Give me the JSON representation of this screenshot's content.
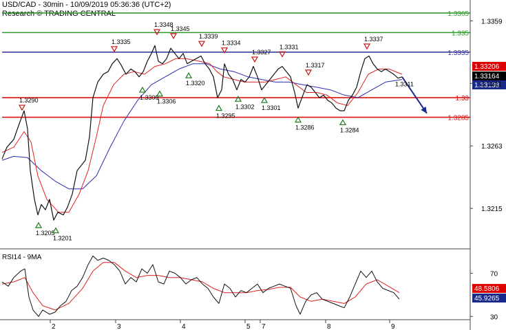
{
  "header": {
    "line1": "USD/CAD - 30min - 10/09/2019 05:36:36 (UTC+2)",
    "line2": "Research © TRADING CENTRAL"
  },
  "rsi_label": "RSI14 - 9MA",
  "chart_data": {
    "type": "line",
    "symbol": "USD/CAD",
    "timeframe": "30min",
    "ylim": [
      1.3185,
      1.3375
    ],
    "rsi_ylim": [
      27,
      90
    ],
    "x_ticks": [
      "2",
      "3",
      "4",
      "5",
      "7",
      "8",
      "9"
    ],
    "y_ticks": [
      "1.3359",
      "1.3311",
      "1.3263",
      "1.3215"
    ],
    "rsi_ticks": [
      "70",
      "30"
    ],
    "levels": [
      {
        "value": 1.3365,
        "label": "1.3365",
        "color": "#2e9a2e"
      },
      {
        "value": 1.335,
        "label": "1.335",
        "color": "#2e9a2e"
      },
      {
        "value": 1.3335,
        "label": "1.3335",
        "color": "#3a3aa0"
      },
      {
        "value": 1.33,
        "label": "1.33",
        "color": "#dd1111"
      },
      {
        "value": 1.3285,
        "label": "1.3285",
        "color": "#dd1111"
      }
    ],
    "price_badges": [
      {
        "label": "1.33206",
        "value": 1.33206,
        "color": "#dd0000"
      },
      {
        "label": "1.33164",
        "value": 1.33164,
        "color": "#000000"
      },
      {
        "label": "1.33138",
        "value": 1.33138,
        "color": "#1a2a8a"
      }
    ],
    "rsi_badges": [
      {
        "label": "48.5806",
        "value": 48.58,
        "color": "#dd0000"
      },
      {
        "label": "45.9265",
        "value": 45.93,
        "color": "#1a2a8a"
      }
    ],
    "annotations": [
      {
        "t": 32,
        "value": 1.329,
        "label": "1.3290",
        "kind": "high"
      },
      {
        "t": 56,
        "value": 1.3205,
        "label": "1.3205",
        "kind": "low"
      },
      {
        "t": 81,
        "value": 1.3201,
        "label": "1.3201",
        "kind": "low"
      },
      {
        "t": 166,
        "value": 1.3335,
        "label": "1.3335",
        "kind": "high"
      },
      {
        "t": 207,
        "value": 1.3309,
        "label": "1.3309",
        "kind": "low"
      },
      {
        "t": 228,
        "value": 1.3348,
        "label": "1.3348",
        "kind": "high"
      },
      {
        "t": 232,
        "value": 1.3306,
        "label": "1.3306",
        "kind": "low"
      },
      {
        "t": 252,
        "value": 1.3345,
        "label": "1.3345",
        "kind": "high"
      },
      {
        "t": 274,
        "value": 1.332,
        "label": "1.3320",
        "kind": "low"
      },
      {
        "t": 293,
        "value": 1.3339,
        "label": "1.3339",
        "kind": "high"
      },
      {
        "t": 318,
        "value": 1.3295,
        "label": "1.3295",
        "kind": "low"
      },
      {
        "t": 326,
        "value": 1.3334,
        "label": "1.3334",
        "kind": "high"
      },
      {
        "t": 346,
        "value": 1.3302,
        "label": "1.3302",
        "kind": "low"
      },
      {
        "t": 370,
        "value": 1.3327,
        "label": "1.3327",
        "kind": "high"
      },
      {
        "t": 384,
        "value": 1.3301,
        "label": "1.3301",
        "kind": "low"
      },
      {
        "t": 410,
        "value": 1.3331,
        "label": "1.3331",
        "kind": "high"
      },
      {
        "t": 433,
        "value": 1.3286,
        "label": "1.3286",
        "kind": "low"
      },
      {
        "t": 448,
        "value": 1.3317,
        "label": "1.3317",
        "kind": "high"
      },
      {
        "t": 498,
        "value": 1.3284,
        "label": "1.3284",
        "kind": "low"
      },
      {
        "t": 533,
        "value": 1.3337,
        "label": "1.3337",
        "kind": "high"
      },
      {
        "t": 580,
        "value": 1.3311,
        "label": "1.3311",
        "kind": "text"
      }
    ],
    "price_path": [
      [
        3,
        1.3253
      ],
      [
        10,
        1.3262
      ],
      [
        20,
        1.3268
      ],
      [
        28,
        1.328
      ],
      [
        35,
        1.329
      ],
      [
        40,
        1.3276
      ],
      [
        44,
        1.3244
      ],
      [
        50,
        1.3222
      ],
      [
        55,
        1.321
      ],
      [
        60,
        1.3218
      ],
      [
        66,
        1.3214
      ],
      [
        72,
        1.3222
      ],
      [
        78,
        1.3206
      ],
      [
        84,
        1.3212
      ],
      [
        92,
        1.321
      ],
      [
        98,
        1.3216
      ],
      [
        105,
        1.3226
      ],
      [
        112,
        1.3244
      ],
      [
        118,
        1.3248
      ],
      [
        124,
        1.3252
      ],
      [
        130,
        1.327
      ],
      [
        135,
        1.33
      ],
      [
        142,
        1.3312
      ],
      [
        150,
        1.3318
      ],
      [
        157,
        1.332
      ],
      [
        163,
        1.3326
      ],
      [
        170,
        1.333
      ],
      [
        176,
        1.3325
      ],
      [
        183,
        1.3318
      ],
      [
        190,
        1.3322
      ],
      [
        196,
        1.332
      ],
      [
        202,
        1.3316
      ],
      [
        208,
        1.332
      ],
      [
        214,
        1.3328
      ],
      [
        220,
        1.3334
      ],
      [
        225,
        1.334
      ],
      [
        230,
        1.3328
      ],
      [
        236,
        1.3326
      ],
      [
        242,
        1.333
      ],
      [
        248,
        1.3338
      ],
      [
        254,
        1.3334
      ],
      [
        260,
        1.333
      ],
      [
        266,
        1.3334
      ],
      [
        272,
        1.3326
      ],
      [
        278,
        1.3328
      ],
      [
        285,
        1.333
      ],
      [
        292,
        1.3332
      ],
      [
        298,
        1.3326
      ],
      [
        304,
        1.3322
      ],
      [
        310,
        1.3316
      ],
      [
        316,
        1.33
      ],
      [
        322,
        1.3306
      ],
      [
        326,
        1.3326
      ],
      [
        332,
        1.3318
      ],
      [
        338,
        1.3314
      ],
      [
        344,
        1.3306
      ],
      [
        350,
        1.3314
      ],
      [
        356,
        1.3312
      ],
      [
        362,
        1.3316
      ],
      [
        368,
        1.3324
      ],
      [
        374,
        1.3316
      ],
      [
        380,
        1.3306
      ],
      [
        386,
        1.331
      ],
      [
        392,
        1.3314
      ],
      [
        398,
        1.3318
      ],
      [
        404,
        1.3322
      ],
      [
        410,
        1.3324
      ],
      [
        416,
        1.332
      ],
      [
        422,
        1.3316
      ],
      [
        428,
        1.3304
      ],
      [
        433,
        1.3292
      ],
      [
        440,
        1.3302
      ],
      [
        446,
        1.331
      ],
      [
        452,
        1.3308
      ],
      [
        458,
        1.3304
      ],
      [
        464,
        1.33
      ],
      [
        470,
        1.3302
      ],
      [
        476,
        1.3298
      ],
      [
        482,
        1.3296
      ],
      [
        488,
        1.3292
      ],
      [
        494,
        1.329
      ],
      [
        500,
        1.329
      ],
      [
        506,
        1.3298
      ],
      [
        512,
        1.3302
      ],
      [
        518,
        1.3308
      ],
      [
        524,
        1.332
      ],
      [
        530,
        1.333
      ],
      [
        536,
        1.3332
      ],
      [
        542,
        1.3326
      ],
      [
        548,
        1.3322
      ],
      [
        554,
        1.332
      ],
      [
        560,
        1.3322
      ],
      [
        566,
        1.332
      ],
      [
        572,
        1.3318
      ],
      [
        578,
        1.3315
      ],
      [
        584,
        1.3316
      ]
    ],
    "ma_fast_path": [
      [
        3,
        1.3258
      ],
      [
        20,
        1.3262
      ],
      [
        35,
        1.3274
      ],
      [
        45,
        1.3266
      ],
      [
        55,
        1.324
      ],
      [
        68,
        1.3222
      ],
      [
        85,
        1.3212
      ],
      [
        100,
        1.3212
      ],
      [
        115,
        1.3226
      ],
      [
        128,
        1.3244
      ],
      [
        140,
        1.327
      ],
      [
        150,
        1.3294
      ],
      [
        165,
        1.331
      ],
      [
        180,
        1.3318
      ],
      [
        195,
        1.332
      ],
      [
        210,
        1.3318
      ],
      [
        225,
        1.3324
      ],
      [
        240,
        1.3326
      ],
      [
        255,
        1.333
      ],
      [
        270,
        1.333
      ],
      [
        290,
        1.3328
      ],
      [
        305,
        1.3326
      ],
      [
        315,
        1.332
      ],
      [
        325,
        1.3316
      ],
      [
        340,
        1.3314
      ],
      [
        355,
        1.3312
      ],
      [
        370,
        1.3312
      ],
      [
        385,
        1.3312
      ],
      [
        400,
        1.3314
      ],
      [
        415,
        1.3316
      ],
      [
        430,
        1.331
      ],
      [
        445,
        1.3304
      ],
      [
        460,
        1.3304
      ],
      [
        475,
        1.3302
      ],
      [
        490,
        1.3296
      ],
      [
        505,
        1.3294
      ],
      [
        520,
        1.3304
      ],
      [
        535,
        1.3318
      ],
      [
        550,
        1.3322
      ],
      [
        565,
        1.3322
      ],
      [
        584,
        1.3318
      ]
    ],
    "ma_slow_path": [
      [
        3,
        1.3252
      ],
      [
        20,
        1.3255
      ],
      [
        40,
        1.3254
      ],
      [
        60,
        1.3244
      ],
      [
        80,
        1.3236
      ],
      [
        100,
        1.323
      ],
      [
        120,
        1.323
      ],
      [
        140,
        1.324
      ],
      [
        160,
        1.3262
      ],
      [
        180,
        1.3282
      ],
      [
        200,
        1.3298
      ],
      [
        220,
        1.331
      ],
      [
        240,
        1.3316
      ],
      [
        260,
        1.3322
      ],
      [
        280,
        1.3326
      ],
      [
        300,
        1.3326
      ],
      [
        320,
        1.3322
      ],
      [
        340,
        1.332
      ],
      [
        360,
        1.3316
      ],
      [
        380,
        1.3314
      ],
      [
        400,
        1.3312
      ],
      [
        420,
        1.3312
      ],
      [
        440,
        1.331
      ],
      [
        460,
        1.3308
      ],
      [
        480,
        1.3306
      ],
      [
        500,
        1.3302
      ],
      [
        520,
        1.33
      ],
      [
        540,
        1.3306
      ],
      [
        560,
        1.3312
      ],
      [
        584,
        1.3314
      ]
    ],
    "forecast_arrow": {
      "from": [
        584,
        1.3316
      ],
      "to": [
        620,
        1.3288
      ]
    },
    "rsi_path": [
      [
        3,
        62
      ],
      [
        12,
        58
      ],
      [
        20,
        66
      ],
      [
        30,
        72
      ],
      [
        36,
        74
      ],
      [
        42,
        48
      ],
      [
        48,
        36
      ],
      [
        56,
        30
      ],
      [
        62,
        36
      ],
      [
        72,
        32
      ],
      [
        80,
        34
      ],
      [
        88,
        40
      ],
      [
        96,
        44
      ],
      [
        104,
        54
      ],
      [
        112,
        58
      ],
      [
        120,
        66
      ],
      [
        128,
        78
      ],
      [
        135,
        86
      ],
      [
        142,
        82
      ],
      [
        150,
        84
      ],
      [
        158,
        82
      ],
      [
        166,
        78
      ],
      [
        174,
        72
      ],
      [
        182,
        60
      ],
      [
        190,
        66
      ],
      [
        198,
        62
      ],
      [
        206,
        74
      ],
      [
        214,
        70
      ],
      [
        222,
        78
      ],
      [
        230,
        62
      ],
      [
        238,
        60
      ],
      [
        246,
        72
      ],
      [
        254,
        70
      ],
      [
        262,
        66
      ],
      [
        270,
        60
      ],
      [
        278,
        64
      ],
      [
        286,
        66
      ],
      [
        294,
        60
      ],
      [
        302,
        56
      ],
      [
        310,
        48
      ],
      [
        318,
        42
      ],
      [
        326,
        60
      ],
      [
        334,
        56
      ],
      [
        342,
        48
      ],
      [
        350,
        54
      ],
      [
        358,
        52
      ],
      [
        366,
        56
      ],
      [
        374,
        60
      ],
      [
        382,
        52
      ],
      [
        390,
        56
      ],
      [
        398,
        58
      ],
      [
        406,
        60
      ],
      [
        414,
        58
      ],
      [
        422,
        56
      ],
      [
        430,
        40
      ],
      [
        436,
        32
      ],
      [
        444,
        44
      ],
      [
        452,
        50
      ],
      [
        460,
        52
      ],
      [
        468,
        46
      ],
      [
        476,
        44
      ],
      [
        484,
        42
      ],
      [
        492,
        40
      ],
      [
        500,
        38
      ],
      [
        508,
        48
      ],
      [
        516,
        60
      ],
      [
        524,
        72
      ],
      [
        532,
        66
      ],
      [
        540,
        72
      ],
      [
        548,
        62
      ],
      [
        556,
        56
      ],
      [
        564,
        54
      ],
      [
        572,
        52
      ],
      [
        580,
        46
      ]
    ],
    "rsi_ma_path": [
      [
        3,
        60
      ],
      [
        20,
        62
      ],
      [
        36,
        66
      ],
      [
        48,
        52
      ],
      [
        62,
        40
      ],
      [
        80,
        36
      ],
      [
        100,
        42
      ],
      [
        120,
        56
      ],
      [
        135,
        72
      ],
      [
        150,
        80
      ],
      [
        166,
        80
      ],
      [
        182,
        72
      ],
      [
        198,
        66
      ],
      [
        214,
        68
      ],
      [
        230,
        68
      ],
      [
        246,
        66
      ],
      [
        262,
        66
      ],
      [
        278,
        64
      ],
      [
        294,
        62
      ],
      [
        310,
        56
      ],
      [
        326,
        52
      ],
      [
        342,
        52
      ],
      [
        358,
        52
      ],
      [
        374,
        54
      ],
      [
        390,
        55
      ],
      [
        406,
        57
      ],
      [
        422,
        57
      ],
      [
        436,
        48
      ],
      [
        452,
        44
      ],
      [
        468,
        46
      ],
      [
        484,
        44
      ],
      [
        500,
        42
      ],
      [
        516,
        48
      ],
      [
        532,
        60
      ],
      [
        548,
        64
      ],
      [
        564,
        58
      ],
      [
        580,
        52
      ]
    ]
  }
}
